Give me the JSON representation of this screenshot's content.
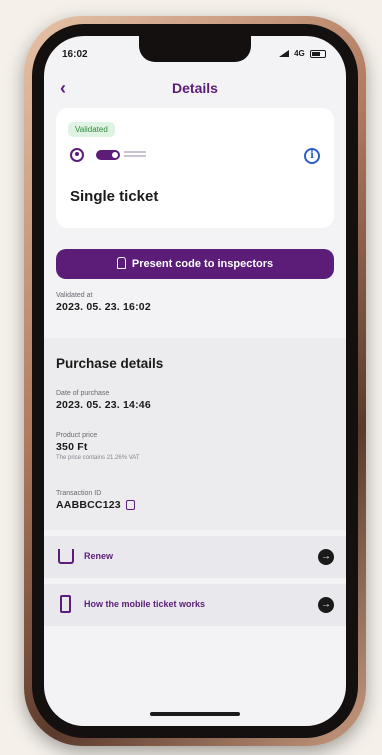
{
  "status_bar": {
    "time": "16:02",
    "network": "4G"
  },
  "header": {
    "back_glyph": "‹",
    "title": "Details"
  },
  "ticket": {
    "status_badge": "Validated",
    "title": "Single ticket",
    "info_glyph": "i"
  },
  "present_button": {
    "label": "Present code to inspectors"
  },
  "validated": {
    "label": "Validated at",
    "value": "2023. 05. 23. 16:02"
  },
  "purchase": {
    "title": "Purchase details",
    "date_label": "Date of purchase",
    "date_value": "2023. 05. 23. 14:46",
    "price_label": "Product price",
    "price_value": "350 Ft",
    "vat_note": "The price contains 21.26% VAT",
    "txn_label": "Transaction ID",
    "txn_value": "AABBCC123"
  },
  "menu": [
    {
      "label": "Renew",
      "icon": "cart-icon"
    },
    {
      "label": "How the mobile ticket works",
      "icon": "phone-icon"
    }
  ],
  "arrow_glyph": "→",
  "colors": {
    "brand": "#5b1d78",
    "validated_green": "#2f8a3f",
    "info_blue": "#2a5fc8"
  }
}
